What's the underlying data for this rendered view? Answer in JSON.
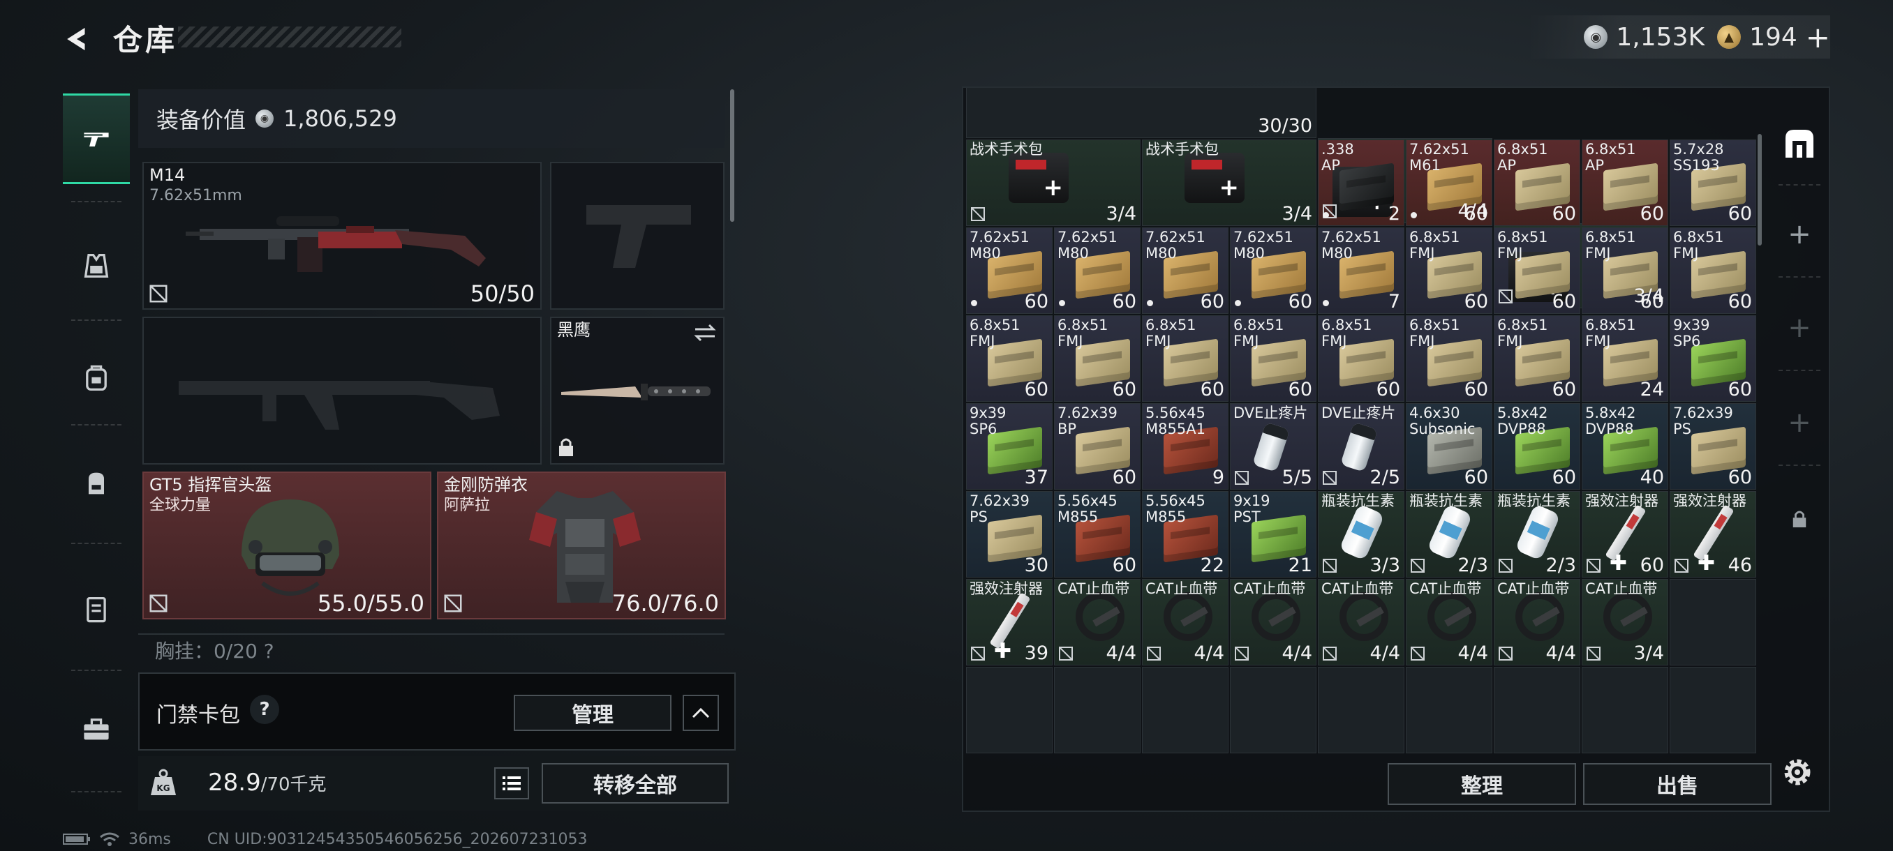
{
  "header": {
    "title": "仓库",
    "silver_amount": "1,153K",
    "gold_amount": "194",
    "plus_label": "+"
  },
  "left_rail": {
    "items": [
      "weapons-icon",
      "vest-icon",
      "rig-icon",
      "backpack-icon",
      "case-icon",
      "toolbox-icon"
    ]
  },
  "equipment": {
    "value_label": "装备价值",
    "value_amount": "1,806,529",
    "primary": {
      "name": "M14",
      "caliber": "7.62x51mm",
      "count": "50/50"
    },
    "knife": {
      "name": "黑鹰"
    },
    "helmet": {
      "name": "GT5 指挥官头盔",
      "sub": "全球力量",
      "durability": "55.0/55.0"
    },
    "armor": {
      "name": "金刚防弹衣",
      "sub": "阿萨拉",
      "durability": "76.0/76.0"
    },
    "chest_label": "胸挂：0/20 ?"
  },
  "access_card": {
    "label": "门禁卡包",
    "help": "?",
    "manage_label": "管理"
  },
  "weight": {
    "current": "28.9",
    "max": "/70千克",
    "transfer_label": "转移全部"
  },
  "status": {
    "ping": "36ms",
    "uid": "CN UID:90312454350546056256_202607231053"
  },
  "stash": {
    "top_partial": [
      {
        "count": "30/30"
      },
      {
        "count": "4/4"
      },
      {
        "count": "3/4"
      }
    ],
    "items": [
      {
        "name": "战术手术包",
        "count": "3/4",
        "art": "kit",
        "bg": "g",
        "span": 2,
        "ins": true
      },
      {
        "name": "战术手术包",
        "count": "3/4",
        "art": "kit",
        "bg": "g",
        "span": 2,
        "ins": false
      },
      {
        "name": ".338\nAP",
        "count": "2",
        "art": "box black",
        "bg": "r",
        "dot": true
      },
      {
        "name": "7.62x51\nM61",
        "count": "60",
        "art": "box tan",
        "bg": "r",
        "dot": true
      },
      {
        "name": "6.8x51\nAP",
        "count": "60",
        "art": "box tan2",
        "bg": "r"
      },
      {
        "name": "6.8x51\nAP",
        "count": "60",
        "art": "box tan2",
        "bg": "r"
      },
      {
        "name": "5.7x28\nSS193",
        "count": "60",
        "art": "box tan2",
        "bg": "p"
      },
      {
        "name": "7.62x51\nM80",
        "count": "60",
        "art": "box tan",
        "bg": "p",
        "dot": true
      },
      {
        "name": "7.62x51\nM80",
        "count": "60",
        "art": "box tan",
        "bg": "p",
        "dot": true
      },
      {
        "name": "7.62x51\nM80",
        "count": "60",
        "art": "box tan",
        "bg": "p",
        "dot": true
      },
      {
        "name": "7.62x51\nM80",
        "count": "60",
        "art": "box tan",
        "bg": "p",
        "dot": true
      },
      {
        "name": "7.62x51\nM80",
        "count": "7",
        "art": "box tan",
        "bg": "p",
        "dot": true
      },
      {
        "name": "6.8x51\nFMJ",
        "count": "60",
        "art": "box tan2",
        "bg": "p"
      },
      {
        "name": "6.8x51\nFMJ",
        "count": "60",
        "art": "box tan2",
        "bg": "p"
      },
      {
        "name": "6.8x51\nFMJ",
        "count": "60",
        "art": "box tan2",
        "bg": "p"
      },
      {
        "name": "6.8x51\nFMJ",
        "count": "60",
        "art": "box tan2",
        "bg": "p"
      },
      {
        "name": "6.8x51\nFMJ",
        "count": "60",
        "art": "box tan2",
        "bg": "p"
      },
      {
        "name": "6.8x51\nFMJ",
        "count": "60",
        "art": "box tan2",
        "bg": "p"
      },
      {
        "name": "6.8x51\nFMJ",
        "count": "60",
        "art": "box tan2",
        "bg": "p"
      },
      {
        "name": "6.8x51\nFMJ",
        "count": "60",
        "art": "box tan2",
        "bg": "p"
      },
      {
        "name": "6.8x51\nFMJ",
        "count": "60",
        "art": "box tan2",
        "bg": "p"
      },
      {
        "name": "6.8x51\nFMJ",
        "count": "60",
        "art": "box tan2",
        "bg": "p"
      },
      {
        "name": "6.8x51\nFMJ",
        "count": "60",
        "art": "box tan2",
        "bg": "p"
      },
      {
        "name": "6.8x51\nFMJ",
        "count": "24",
        "art": "box tan2",
        "bg": "p"
      },
      {
        "name": "9x39\nSP6",
        "count": "60",
        "art": "box green",
        "bg": "p"
      },
      {
        "name": "9x39\nSP6",
        "count": "37",
        "art": "box green",
        "bg": "p"
      },
      {
        "name": "7.62x39\nBP",
        "count": "60",
        "art": "box tan2",
        "bg": "p"
      },
      {
        "name": "5.56x45\nM855A1",
        "count": "9",
        "art": "box red",
        "bg": "p"
      },
      {
        "name": "DVE止疼片",
        "count": "5/5",
        "art": "pill",
        "bg": "p",
        "ins": true
      },
      {
        "name": "DVE止疼片",
        "count": "2/5",
        "art": "pill",
        "bg": "p",
        "ins": true
      },
      {
        "name": "4.6x30\nSubsonic",
        "count": "60",
        "art": "box grey",
        "bg": "b"
      },
      {
        "name": "5.8x42\nDVP88",
        "count": "60",
        "art": "box green",
        "bg": "b"
      },
      {
        "name": "5.8x42\nDVP88",
        "count": "40",
        "art": "box green",
        "bg": "b"
      },
      {
        "name": "7.62x39\nPS",
        "count": "60",
        "art": "box tan2",
        "bg": "b"
      },
      {
        "name": "7.62x39\nPS",
        "count": "30",
        "art": "box tan2",
        "bg": "b"
      },
      {
        "name": "5.56x45\nM855",
        "count": "60",
        "art": "box red",
        "bg": "b"
      },
      {
        "name": "5.56x45\nM855",
        "count": "22",
        "art": "box red",
        "bg": "b"
      },
      {
        "name": "9x19\nPST",
        "count": "21",
        "art": "box green",
        "bg": "b"
      },
      {
        "name": "瓶装抗生素",
        "count": "3/3",
        "art": "bottle",
        "bg": "g",
        "ins": true
      },
      {
        "name": "瓶装抗生素",
        "count": "2/3",
        "art": "bottle",
        "bg": "g",
        "ins": true
      },
      {
        "name": "瓶装抗生素",
        "count": "2/3",
        "art": "bottle",
        "bg": "g",
        "ins": true
      },
      {
        "name": "强效注射器",
        "count": "60",
        "art": "syringe",
        "bg": "g",
        "ins": true,
        "plus": true
      },
      {
        "name": "强效注射器",
        "count": "46",
        "art": "syringe",
        "bg": "g",
        "ins": true,
        "plus": true
      },
      {
        "name": "强效注射器",
        "count": "39",
        "art": "syringe",
        "bg": "g",
        "ins": true,
        "plus": true
      },
      {
        "name": "CAT止血带",
        "count": "4/4",
        "art": "tq",
        "bg": "g",
        "ins": true
      },
      {
        "name": "CAT止血带",
        "count": "4/4",
        "art": "tq",
        "bg": "g",
        "ins": true
      },
      {
        "name": "CAT止血带",
        "count": "4/4",
        "art": "tq",
        "bg": "g",
        "ins": true
      },
      {
        "name": "CAT止血带",
        "count": "4/4",
        "art": "tq",
        "bg": "g",
        "ins": true
      },
      {
        "name": "CAT止血带",
        "count": "4/4",
        "art": "tq",
        "bg": "g",
        "ins": true
      },
      {
        "name": "CAT止血带",
        "count": "4/4",
        "art": "tq",
        "bg": "g",
        "ins": true
      },
      {
        "name": "CAT止血带",
        "count": "3/4",
        "art": "tq",
        "bg": "g",
        "ins": true
      }
    ],
    "sort_label": "整理",
    "sell_label": "出售"
  },
  "colors": {
    "accent": "#2fd9a5",
    "rarity_red": "#5b2f31",
    "rarity_green": "#23332b",
    "rarity_purple": "#2d3040",
    "rarity_blue": "#22303c"
  }
}
